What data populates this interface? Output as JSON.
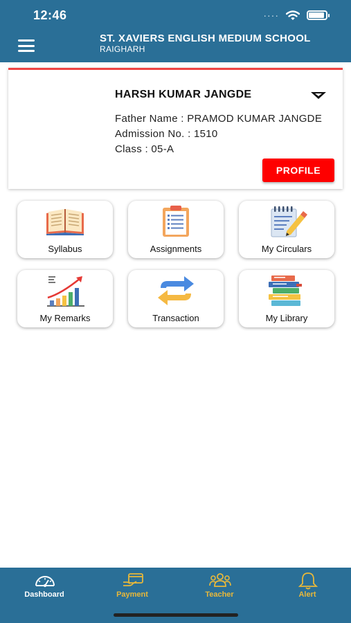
{
  "status_bar": {
    "time": "12:46"
  },
  "header": {
    "school_name": "ST. XAVIERS ENGLISH MEDIUM SCHOOL",
    "city": "RAIGHARH"
  },
  "student": {
    "name": "HARSH KUMAR JANGDE",
    "father": "Father Name : PRAMOD KUMAR JANGDE",
    "admission": "Admission No. : 1510",
    "class": "Class : 05-A",
    "profile_button": "PROFILE"
  },
  "tiles": [
    {
      "label": "Syllabus",
      "icon": "book-icon"
    },
    {
      "label": "Assignments",
      "icon": "clipboard-icon"
    },
    {
      "label": "My Circulars",
      "icon": "notepad-pencil-icon"
    },
    {
      "label": "My Remarks",
      "icon": "growth-chart-icon"
    },
    {
      "label": "Transaction",
      "icon": "exchange-arrows-icon"
    },
    {
      "label": "My Library",
      "icon": "books-stack-icon"
    }
  ],
  "bottom_nav": [
    {
      "label": "Dashboard",
      "icon": "speedometer-icon",
      "color": "#ffffff"
    },
    {
      "label": "Payment",
      "icon": "payment-hand-icon",
      "color": "#e8b83a"
    },
    {
      "label": "Teacher",
      "icon": "group-icon",
      "color": "#e8b83a"
    },
    {
      "label": "Alert",
      "icon": "bell-icon",
      "color": "#e8b83a"
    }
  ],
  "colors": {
    "primary": "#2a6f97",
    "accent_red": "#fe0000",
    "inactive_nav": "#e8b83a"
  }
}
